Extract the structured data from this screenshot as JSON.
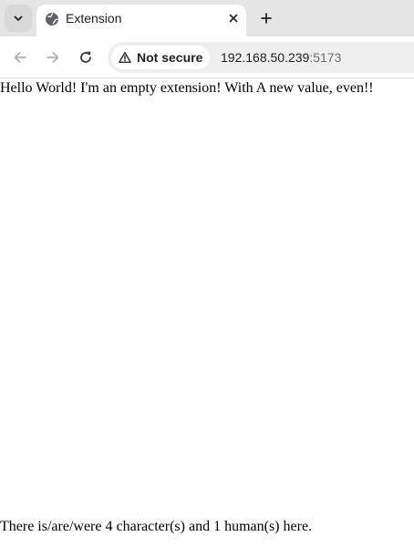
{
  "browser": {
    "tab": {
      "title": "Extension"
    },
    "toolbar": {
      "security_label": "Not secure",
      "url_host": "192.168.50.239",
      "url_port": ":5173"
    }
  },
  "page": {
    "greeting": "Hello World! I'm an empty extension! With A new value, even!!",
    "footer": "There is/are/were 4 character(s) and 1 human(s) here."
  },
  "colors": {
    "tabstrip_bg": "#e5e5e5",
    "omnibox_bg": "#efefef",
    "text": "#1f1f1f",
    "port_text": "#6f6f6f"
  }
}
